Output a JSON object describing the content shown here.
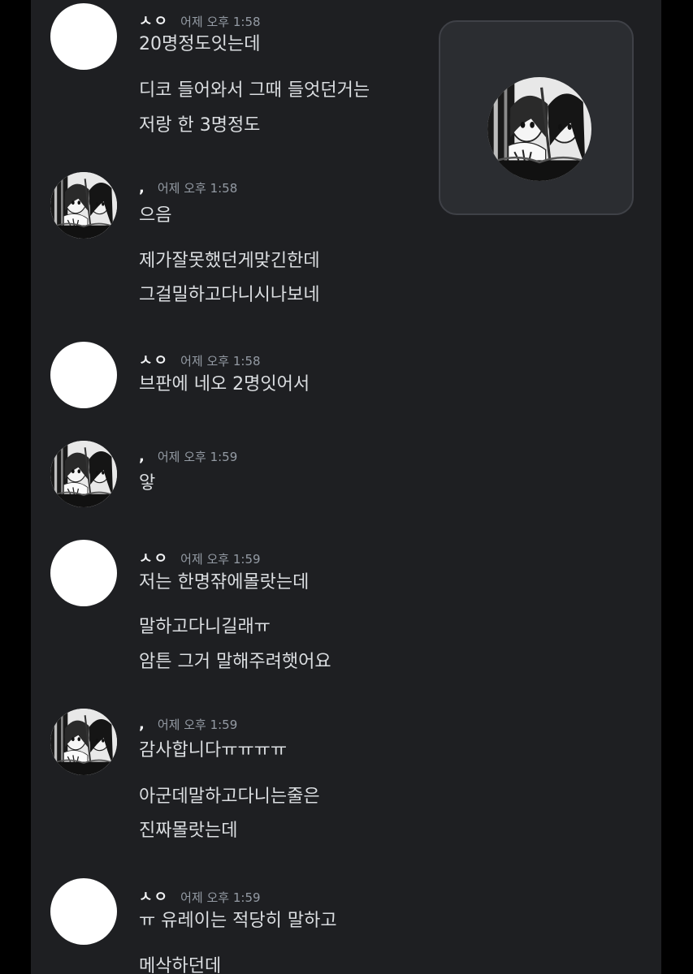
{
  "voice_tile": {
    "avatar_icon": "manga-avatar-icon"
  },
  "messages": [
    {
      "author": "ㅅㅇ",
      "timestamp": "어제 오후 1:58",
      "avatar": "blank",
      "lines": [
        "20명정도잇는데",
        "디코 들어와서 그때 들엇던거는",
        "저랑 한 3명정도"
      ]
    },
    {
      "author": ",",
      "timestamp": "어제 오후 1:58",
      "avatar": "manga",
      "lines": [
        "으음",
        "제가잘못했던게맞긴한데",
        "그걸밀하고다니시나보네"
      ]
    },
    {
      "author": "ㅅㅇ",
      "timestamp": "어제 오후 1:58",
      "avatar": "blank",
      "lines": [
        "브판에 네오 2명잇어서"
      ]
    },
    {
      "author": ",",
      "timestamp": "어제 오후 1:59",
      "avatar": "manga",
      "lines": [
        "앟"
      ]
    },
    {
      "author": "ㅅㅇ",
      "timestamp": "어제 오후 1:59",
      "avatar": "blank",
      "lines": [
        "저는 한명쟊에몰랏는데",
        "말하고다니길래ㅠ",
        "암튼 그거 말해주려햇어요"
      ]
    },
    {
      "author": ",",
      "timestamp": "어제 오후 1:59",
      "avatar": "manga",
      "lines": [
        "감사합니다ㅠㅠㅠㅠ",
        "아군데말하고다니는줄은",
        "진짜몰랏는데"
      ]
    },
    {
      "author": "ㅅㅇ",
      "timestamp": "어제 오후 1:59",
      "avatar": "blank",
      "lines": [
        "ㅠ 유레이는 적당히 말하고",
        "메삭하던데"
      ]
    }
  ],
  "colors": {
    "background": "#1e1f22",
    "username": "#f2f3f5",
    "timestamp": "#949ba4",
    "text": "#dbdee1",
    "tile": "#2b2d31"
  }
}
